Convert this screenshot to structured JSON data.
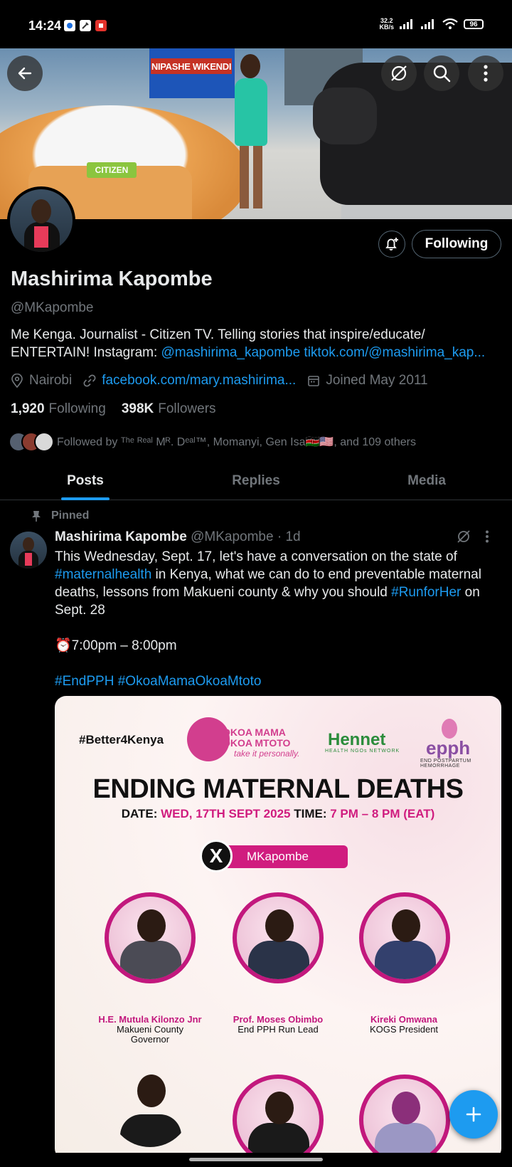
{
  "status_bar": {
    "time": "14:24",
    "speed_value": "32.2",
    "speed_unit": "KB/s",
    "battery": "96"
  },
  "banner": {
    "sign_text": "NIPASHE WIKENDI",
    "desk_logo": "CITIZEN"
  },
  "profile": {
    "name": "Mashirima Kapombe",
    "handle": "@MKapombe",
    "follow_button": "Following",
    "bio_text": "Me Kenga. Journalist - Citizen TV. Telling stories that inspire/educate/ ENTERTAIN! Instagram: ",
    "bio_link": "@mashirima_kapombe tiktok.com/@mashirima_kap...",
    "location": "Nairobi",
    "website": "facebook.com/mary.mashirima...",
    "joined": "Joined May 2011",
    "following_count": "1,920",
    "following_label": "Following",
    "followers_count": "398K",
    "followers_label": "Followers",
    "followed_by": "Followed by ᵀʰᵉ ᴿᵉᵃˡ Mᴿ. Dᵉᵃˡ™, Momanyi, Gen Isa🇰🇪🇺🇸, and 109 others"
  },
  "tabs": [
    {
      "label": "Posts"
    },
    {
      "label": "Replies"
    },
    {
      "label": "Media"
    }
  ],
  "post": {
    "pinned_label": "Pinned",
    "author_name": "Mashirima Kapombe",
    "author_meta": "@MKapombe · 1d",
    "p1_a": "This Wednesday, Sept. 17, let's have a conversation on the state of ",
    "p1_tag1": "#maternalhealth",
    "p1_b": " in Kenya, what we can do to end preventable maternal deaths, lessons from Makueni county & why you should ",
    "p1_tag2": "#RunforHer",
    "p1_c": " on Sept. 28",
    "p2": "⏰7:00pm – 8:00pm",
    "p3_tags": "#EndPPH #OkoaMamaOkoaMtoto"
  },
  "card": {
    "hashtag": "#Better4Kenya",
    "okoa_line1": "OKOA MAMA",
    "okoa_line2": "OKOA MTOTO",
    "okoa_tagline": "take it personally.",
    "hennet": "Hennet",
    "hennet_sub": "HEALTH NGOs NETWORK",
    "epph": "epph",
    "epph_sub": "END POSTPARTUM HEMORRHAGE",
    "title": "ENDING MATERNAL DEATHS",
    "date_label": "DATE:",
    "date_value": "WED, 17TH SEPT 2025",
    "time_label": "TIME:",
    "time_value": "7 PM – 8 PM (EAT)",
    "x_logo": "X",
    "x_handle": "MKapombe",
    "speakers": [
      {
        "name": "H.E. Mutula Kilonzo Jnr",
        "role": "Makueni County Governor"
      },
      {
        "name": "Prof. Moses Obimbo",
        "role": "End PPH Run Lead"
      },
      {
        "name": "Kireki Omwana",
        "role": "KOGS President"
      }
    ]
  }
}
